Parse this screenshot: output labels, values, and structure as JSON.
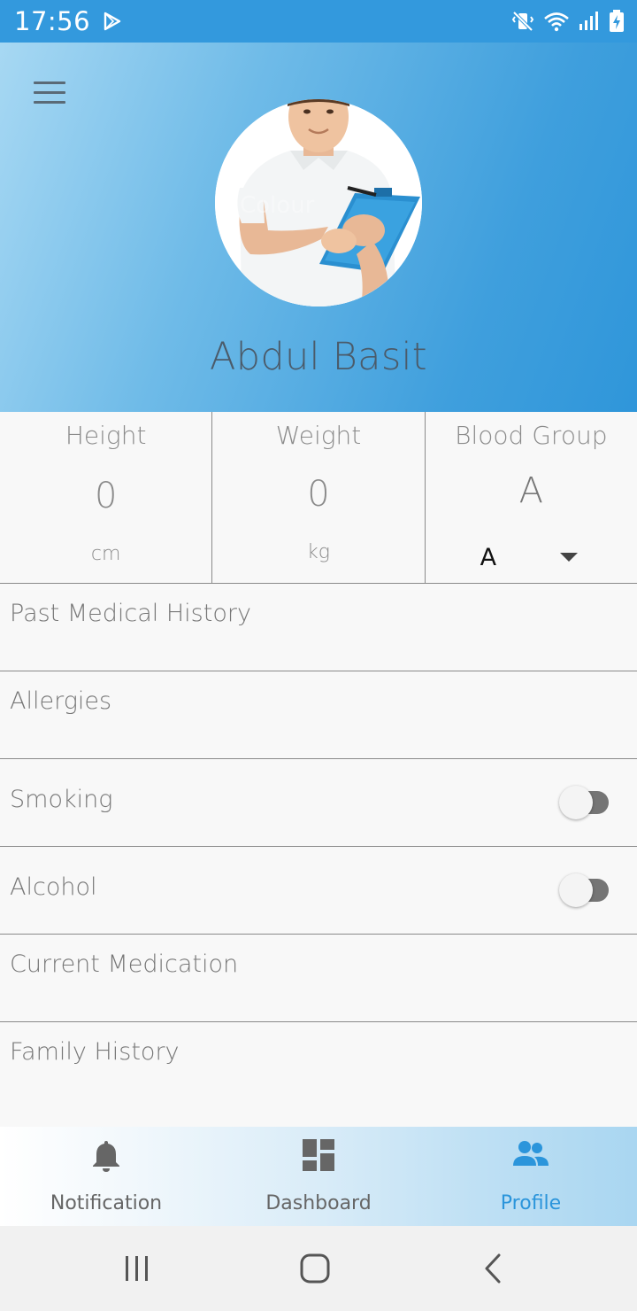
{
  "status_bar": {
    "time": "17:56",
    "icons": [
      "play-store-icon",
      "mute-vibrate-icon",
      "wifi-icon",
      "signal-icon",
      "battery-charging-icon"
    ]
  },
  "header": {
    "menu_icon": "hamburger-menu-icon",
    "profile_name": "Abdul Basit",
    "colors": {
      "gradient_start": "#a7d8f3",
      "gradient_end": "#2f96da",
      "name_color": "#4b5b6a"
    }
  },
  "stats": {
    "height": {
      "title": "Height",
      "value": "0",
      "unit": "cm"
    },
    "weight": {
      "title": "Weight",
      "value": "0",
      "unit": "kg"
    },
    "blood_group": {
      "title": "Blood Group",
      "value": "A",
      "selected": "A"
    }
  },
  "list": {
    "past_medical_history": "Past Medical History",
    "allergies": "Allergies",
    "smoking": {
      "label": "Smoking",
      "on": false
    },
    "alcohol": {
      "label": "Alcohol",
      "on": false
    },
    "current_medication": "Current Medication",
    "family_history": "Family History"
  },
  "bottom_nav": {
    "items": [
      {
        "label": "Notification",
        "icon": "bell-icon",
        "active": false
      },
      {
        "label": "Dashboard",
        "icon": "dashboard-icon",
        "active": false
      },
      {
        "label": "Profile",
        "icon": "people-icon",
        "active": true
      }
    ],
    "accent": "#2b95db"
  },
  "system_nav": {
    "icons": [
      "recents-icon",
      "home-icon",
      "back-icon"
    ]
  }
}
